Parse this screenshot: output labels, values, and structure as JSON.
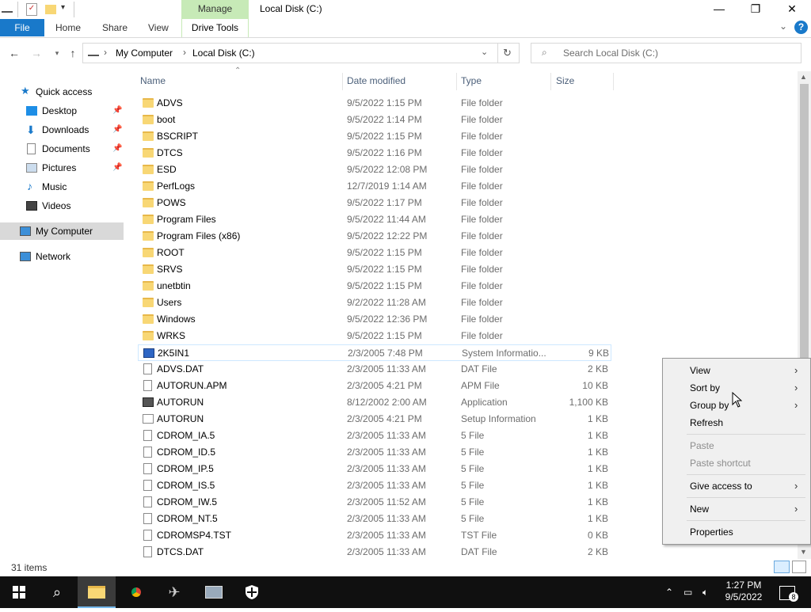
{
  "window": {
    "title": "Local Disk (C:)",
    "manage_tab": "Manage",
    "min": "—",
    "max": "❐",
    "close": "✕"
  },
  "ribbon": {
    "tabs": [
      "File",
      "Home",
      "Share",
      "View",
      "Drive Tools"
    ],
    "help": "?",
    "collapse": "⌄"
  },
  "address": {
    "segments": [
      "My Computer",
      "Local Disk (C:)"
    ],
    "sep": "›",
    "search_placeholder": "Search Local Disk (C:)"
  },
  "sidebar": {
    "quick_access": "Quick access",
    "items": [
      {
        "label": "Desktop",
        "pinned": true
      },
      {
        "label": "Downloads",
        "pinned": true
      },
      {
        "label": "Documents",
        "pinned": true
      },
      {
        "label": "Pictures",
        "pinned": true
      },
      {
        "label": "Music",
        "pinned": false
      },
      {
        "label": "Videos",
        "pinned": false
      }
    ],
    "my_computer": "My Computer",
    "network": "Network"
  },
  "columns": {
    "name": "Name",
    "date": "Date modified",
    "type": "Type",
    "size": "Size"
  },
  "files": [
    {
      "name": "ADVS",
      "date": "9/5/2022 1:15 PM",
      "type": "File folder",
      "size": "",
      "icon": "folder"
    },
    {
      "name": "boot",
      "date": "9/5/2022 1:14 PM",
      "type": "File folder",
      "size": "",
      "icon": "folder"
    },
    {
      "name": "BSCRIPT",
      "date": "9/5/2022 1:15 PM",
      "type": "File folder",
      "size": "",
      "icon": "folder"
    },
    {
      "name": "DTCS",
      "date": "9/5/2022 1:16 PM",
      "type": "File folder",
      "size": "",
      "icon": "folder"
    },
    {
      "name": "ESD",
      "date": "9/5/2022 12:08 PM",
      "type": "File folder",
      "size": "",
      "icon": "folder"
    },
    {
      "name": "PerfLogs",
      "date": "12/7/2019 1:14 AM",
      "type": "File folder",
      "size": "",
      "icon": "folder"
    },
    {
      "name": "POWS",
      "date": "9/5/2022 1:17 PM",
      "type": "File folder",
      "size": "",
      "icon": "folder"
    },
    {
      "name": "Program Files",
      "date": "9/5/2022 11:44 AM",
      "type": "File folder",
      "size": "",
      "icon": "folder"
    },
    {
      "name": "Program Files (x86)",
      "date": "9/5/2022 12:22 PM",
      "type": "File folder",
      "size": "",
      "icon": "folder"
    },
    {
      "name": "ROOT",
      "date": "9/5/2022 1:15 PM",
      "type": "File folder",
      "size": "",
      "icon": "folder"
    },
    {
      "name": "SRVS",
      "date": "9/5/2022 1:15 PM",
      "type": "File folder",
      "size": "",
      "icon": "folder"
    },
    {
      "name": "unetbtin",
      "date": "9/5/2022 1:15 PM",
      "type": "File folder",
      "size": "",
      "icon": "folder"
    },
    {
      "name": "Users",
      "date": "9/2/2022 11:28 AM",
      "type": "File folder",
      "size": "",
      "icon": "folder"
    },
    {
      "name": "Windows",
      "date": "9/5/2022 12:36 PM",
      "type": "File folder",
      "size": "",
      "icon": "folder"
    },
    {
      "name": "WRKS",
      "date": "9/5/2022 1:15 PM",
      "type": "File folder",
      "size": "",
      "icon": "folder"
    },
    {
      "name": "2K5IN1",
      "date": "2/3/2005 7:48 PM",
      "type": "System Informatio...",
      "size": "9 KB",
      "icon": "sysinfo"
    },
    {
      "name": "ADVS.DAT",
      "date": "2/3/2005 11:33 AM",
      "type": "DAT File",
      "size": "2 KB",
      "icon": "doc"
    },
    {
      "name": "AUTORUN.APM",
      "date": "2/3/2005 4:21 PM",
      "type": "APM File",
      "size": "10 KB",
      "icon": "doc"
    },
    {
      "name": "AUTORUN",
      "date": "8/12/2002 2:00 AM",
      "type": "Application",
      "size": "1,100 KB",
      "icon": "app"
    },
    {
      "name": "AUTORUN",
      "date": "2/3/2005 4:21 PM",
      "type": "Setup Information",
      "size": "1 KB",
      "icon": "setup"
    },
    {
      "name": "CDROM_IA.5",
      "date": "2/3/2005 11:33 AM",
      "type": "5 File",
      "size": "1 KB",
      "icon": "doc"
    },
    {
      "name": "CDROM_ID.5",
      "date": "2/3/2005 11:33 AM",
      "type": "5 File",
      "size": "1 KB",
      "icon": "doc"
    },
    {
      "name": "CDROM_IP.5",
      "date": "2/3/2005 11:33 AM",
      "type": "5 File",
      "size": "1 KB",
      "icon": "doc"
    },
    {
      "name": "CDROM_IS.5",
      "date": "2/3/2005 11:33 AM",
      "type": "5 File",
      "size": "1 KB",
      "icon": "doc"
    },
    {
      "name": "CDROM_IW.5",
      "date": "2/3/2005 11:52 AM",
      "type": "5 File",
      "size": "1 KB",
      "icon": "doc"
    },
    {
      "name": "CDROM_NT.5",
      "date": "2/3/2005 11:33 AM",
      "type": "5 File",
      "size": "1 KB",
      "icon": "doc"
    },
    {
      "name": "CDROMSP4.TST",
      "date": "2/3/2005 11:33 AM",
      "type": "TST File",
      "size": "0 KB",
      "icon": "doc"
    },
    {
      "name": "DTCS.DAT",
      "date": "2/3/2005 11:33 AM",
      "type": "DAT File",
      "size": "2 KB",
      "icon": "doc"
    }
  ],
  "status": {
    "items": "31 items"
  },
  "context_menu": {
    "items": [
      {
        "label": "View",
        "submenu": true,
        "disabled": false
      },
      {
        "label": "Sort by",
        "submenu": true,
        "disabled": false
      },
      {
        "label": "Group by",
        "submenu": true,
        "disabled": false
      },
      {
        "label": "Refresh",
        "submenu": false,
        "disabled": false
      },
      {
        "label": "Paste",
        "submenu": false,
        "disabled": true
      },
      {
        "label": "Paste shortcut",
        "submenu": false,
        "disabled": true
      },
      {
        "label": "Give access to",
        "submenu": true,
        "disabled": false
      },
      {
        "label": "New",
        "submenu": true,
        "disabled": false
      },
      {
        "label": "Properties",
        "submenu": false,
        "disabled": false
      }
    ]
  },
  "taskbar": {
    "time": "1:27 PM",
    "date": "9/5/2022",
    "notif_count": "8"
  },
  "colors": {
    "accent": "#1979ca",
    "manage": "#c7eab7",
    "selection": "#cce8ff"
  }
}
